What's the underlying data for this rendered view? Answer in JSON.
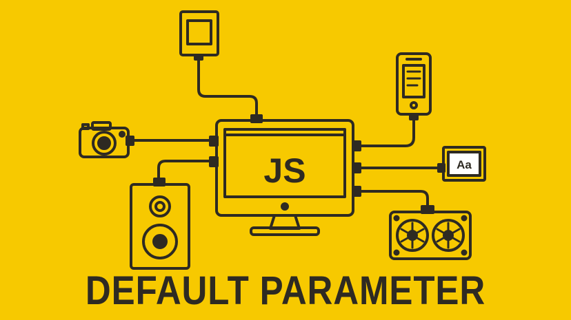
{
  "monitor": {
    "logo_text": "JS"
  },
  "font_card": {
    "text": "Aa"
  },
  "title": {
    "text": "DEFAULT PARAMETER"
  },
  "colors": {
    "background": "#f7c900",
    "stroke": "#2e2a22"
  }
}
